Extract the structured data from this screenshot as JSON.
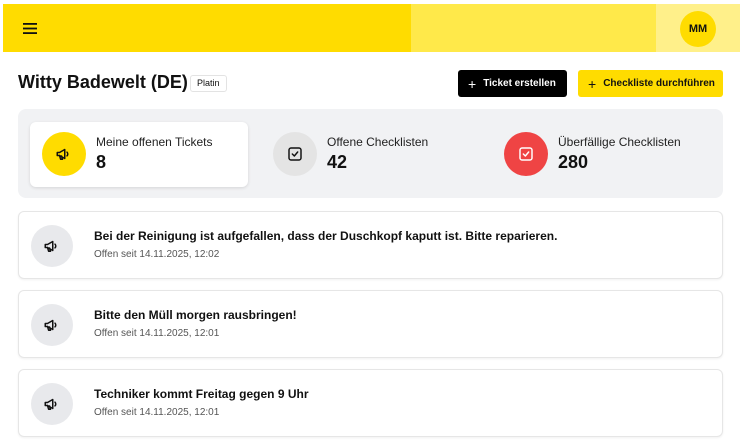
{
  "header": {
    "avatar_initials": "MM",
    "colors": {
      "primary": "#ffdc00",
      "mid": "#ffe94a",
      "light": "#fff08a"
    }
  },
  "page": {
    "title": "Witty Badewelt (DE)",
    "badge": "Platin"
  },
  "actions": {
    "create_ticket": "Ticket erstellen",
    "run_checklist": "Checkliste durchführen"
  },
  "stats": [
    {
      "label": "Meine offenen Tickets",
      "value": "8",
      "icon": "megaphone-icon",
      "color": "#ffdc00"
    },
    {
      "label": "Offene Checklisten",
      "value": "42",
      "icon": "checkbox-icon",
      "color": "#e4e4e4"
    },
    {
      "label": "Überfällige Checklisten",
      "value": "280",
      "icon": "checkbox-icon",
      "color": "#ef4444"
    }
  ],
  "tickets": [
    {
      "title": "Bei der Reinigung ist aufgefallen, dass der Duschkopf kaputt ist. Bitte reparieren.",
      "subtitle": "Offen seit 14.11.2025, 12:02"
    },
    {
      "title": "Bitte den Müll morgen rausbringen!",
      "subtitle": "Offen seit 14.11.2025, 12:01"
    },
    {
      "title": "Techniker kommt Freitag gegen 9 Uhr",
      "subtitle": "Offen seit 14.11.2025, 12:01"
    }
  ]
}
